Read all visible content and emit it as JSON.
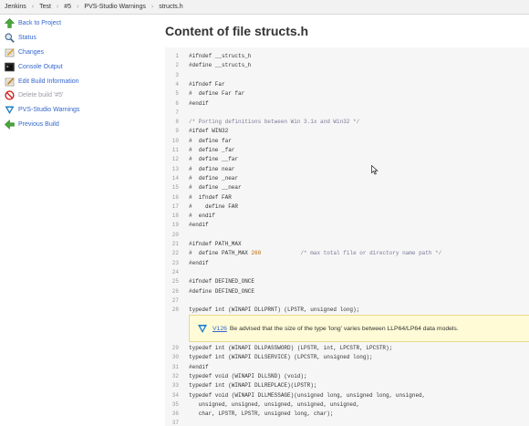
{
  "breadcrumb": [
    "Jenkins",
    "Test",
    "#5",
    "PVS-Studio Warnings",
    "structs.h"
  ],
  "breadcrumb_separator": "›",
  "sidebar": [
    {
      "label": "Back to Project",
      "icon": "up-arrow-icon"
    },
    {
      "label": "Status",
      "icon": "magnifier-icon"
    },
    {
      "label": "Changes",
      "icon": "notepad-icon"
    },
    {
      "label": "Console Output",
      "icon": "terminal-icon"
    },
    {
      "label": "Edit Build Information",
      "icon": "notepad-edit-icon"
    },
    {
      "label": "Delete build '#5'",
      "icon": "no-entry-icon",
      "disabled": true
    },
    {
      "label": "PVS-Studio Warnings",
      "icon": "pvs-studio-icon"
    },
    {
      "label": "Previous Build",
      "icon": "left-arrow-icon"
    }
  ],
  "title": "Content of file structs.h",
  "code_lines_top": [
    {
      "n": "1",
      "text": "#ifndef __structs_h"
    },
    {
      "n": "2",
      "text": "#define __structs_h"
    },
    {
      "n": "3",
      "text": ""
    },
    {
      "n": "4",
      "text": "#ifndef Far"
    },
    {
      "n": "5",
      "text": "#  define Far far"
    },
    {
      "n": "6",
      "text": "#endif"
    },
    {
      "n": "7",
      "text": ""
    },
    {
      "n": "8",
      "text": "/* Porting definitions between Win 3.1x and Win32 */"
    },
    {
      "n": "9",
      "text": "#ifdef WIN32"
    },
    {
      "n": "10",
      "text": "#  define far"
    },
    {
      "n": "11",
      "text": "#  define _far"
    },
    {
      "n": "12",
      "text": "#  define __far"
    },
    {
      "n": "13",
      "text": "#  define near"
    },
    {
      "n": "14",
      "text": "#  define _near"
    },
    {
      "n": "15",
      "text": "#  define __near"
    },
    {
      "n": "16",
      "text": "#  ifndef FAR"
    },
    {
      "n": "17",
      "text": "#    define FAR"
    },
    {
      "n": "18",
      "text": "#  endif"
    },
    {
      "n": "19",
      "text": "#endif"
    },
    {
      "n": "20",
      "text": ""
    },
    {
      "n": "21",
      "text": "#ifndef PATH_MAX"
    },
    {
      "n": "22",
      "text": "#  define PATH_MAX 260            /* max total file or directory name path */"
    },
    {
      "n": "23",
      "text": "#endif"
    },
    {
      "n": "24",
      "text": ""
    },
    {
      "n": "25",
      "text": "#ifndef DEFINED_ONCE"
    },
    {
      "n": "26",
      "text": "#define DEFINED_ONCE"
    },
    {
      "n": "27",
      "text": ""
    },
    {
      "n": "28",
      "text": "typedef int (WINAPI DLLPRNT) (LPSTR, unsigned long);"
    }
  ],
  "warning": {
    "code": "V126",
    "text": "Be advised that the size of the type 'long' varies between LLP64/LP64 data models."
  },
  "code_lines_bottom": [
    {
      "n": "29",
      "text": "typedef int (WINAPI DLLPASSWORD) (LPSTR, int, LPCSTR, LPCSTR);"
    },
    {
      "n": "30",
      "text": "typedef int (WINAPI DLLSERVICE) (LPCSTR, unsigned long);"
    },
    {
      "n": "31",
      "text": "#endif"
    },
    {
      "n": "32",
      "text": "typedef void (WINAPI DLLSND) (void);"
    },
    {
      "n": "33",
      "text": "typedef int (WINAPI DLLREPLACE)(LPSTR);"
    },
    {
      "n": "34",
      "text": "typedef void (WINAPI DLLMESSAGE)(unsigned long, unsigned long, unsigned,"
    },
    {
      "n": "35",
      "text": "   unsigned, unsigned, unsigned, unsigned, unsigned,"
    },
    {
      "n": "36",
      "text": "   char, LPSTR, LPSTR, unsigned long, char);"
    },
    {
      "n": "37",
      "text": ""
    }
  ]
}
